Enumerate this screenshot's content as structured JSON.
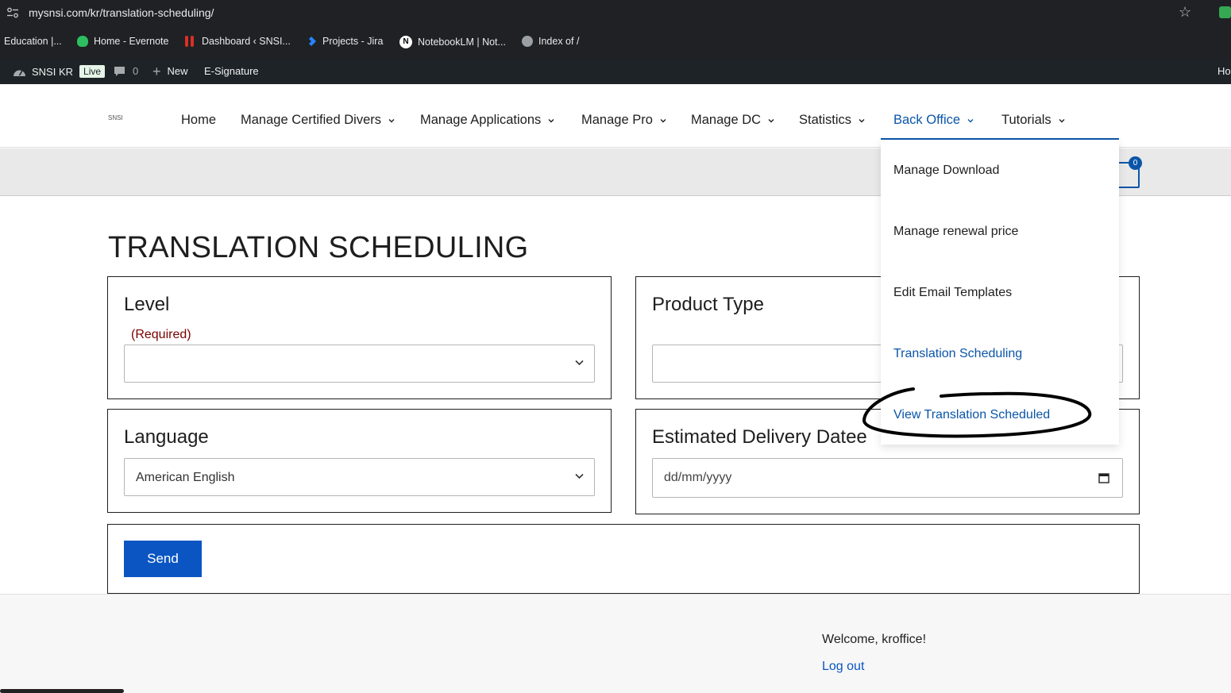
{
  "browser": {
    "url": "mysnsi.com/kr/translation-scheduling/",
    "bookmarks": [
      {
        "label": "Education |..."
      },
      {
        "label": "Home - Evernote"
      },
      {
        "label": "Dashboard ‹ SNSI..."
      },
      {
        "label": "Projects - Jira"
      },
      {
        "label": "NotebookLM | Not..."
      },
      {
        "label": "Index of /"
      }
    ]
  },
  "adminbar": {
    "site_name": "SNSI KR",
    "live_label": "Live",
    "comments_count": "0",
    "new_label": "New",
    "esignature_label": "E-Signature",
    "right_label": "Ho"
  },
  "nav": {
    "logo_text": "SNSI",
    "items": [
      {
        "label": "Home"
      },
      {
        "label": "Manage Certified Divers"
      },
      {
        "label": "Manage Applications"
      },
      {
        "label": "Manage Pro"
      },
      {
        "label": "Manage DC"
      },
      {
        "label": "Statistics"
      },
      {
        "label": "Back Office"
      },
      {
        "label": "Tutorials"
      }
    ]
  },
  "cart": {
    "count": "0"
  },
  "dropdown": {
    "items": [
      {
        "label": "Manage Download"
      },
      {
        "label": "Manage renewal price"
      },
      {
        "label": "Edit Email Templates"
      },
      {
        "label": "Translation Scheduling"
      },
      {
        "label": "View Translation Scheduled"
      }
    ]
  },
  "form": {
    "title": "TRANSLATION SCHEDULING",
    "level_label": "Level",
    "level_required": "(Required)",
    "level_value": "",
    "product_type_label": "Product Type",
    "product_type_value": "",
    "language_label": "Language",
    "language_value": "American English",
    "delivery_label": "Estimated Delivery Datee",
    "delivery_placeholder": "dd/mm/yyyy",
    "send_label": "Send"
  },
  "footer": {
    "welcome": "Welcome, kroffice!",
    "logout": "Log out"
  },
  "colors": {
    "accent": "#0a55a8",
    "button": "#0a55c2",
    "required": "#7a0000"
  }
}
